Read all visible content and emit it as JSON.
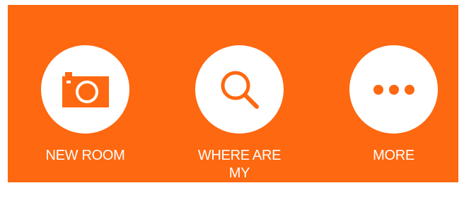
{
  "colors": {
    "accent": "#fd6810",
    "icon_bg": "#ffffff",
    "text": "#ffffff"
  },
  "actions": [
    {
      "label": "NEW ROOM",
      "icon": "camera-icon"
    },
    {
      "label": "WHERE ARE\nMY DEVICES?",
      "icon": "search-icon"
    },
    {
      "label": "MORE",
      "icon": "more-dots-icon"
    }
  ]
}
